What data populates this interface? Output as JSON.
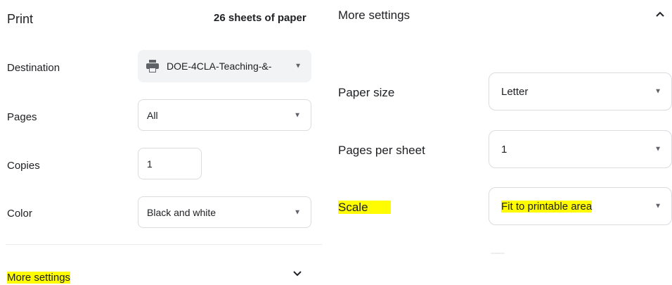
{
  "left": {
    "title": "Print",
    "sheets": "26 sheets of paper",
    "destination": {
      "label": "Destination",
      "value": "DOE-4CLA-Teaching-&-"
    },
    "pages": {
      "label": "Pages",
      "value": "All"
    },
    "copies": {
      "label": "Copies",
      "value": "1"
    },
    "color": {
      "label": "Color",
      "value": "Black and white"
    },
    "more_settings": {
      "label": "More settings",
      "chevron": "chevron-down-icon"
    }
  },
  "right": {
    "title": "More settings",
    "chevron": "chevron-up-icon",
    "paper_size": {
      "label": "Paper size",
      "value": "Letter"
    },
    "pages_per_sheet": {
      "label": "Pages per sheet",
      "value": "1"
    },
    "scale": {
      "label": "Scale",
      "value": "Fit to printable area"
    }
  },
  "colors": {
    "highlight": "#fffb00",
    "border": "#dadce0"
  }
}
